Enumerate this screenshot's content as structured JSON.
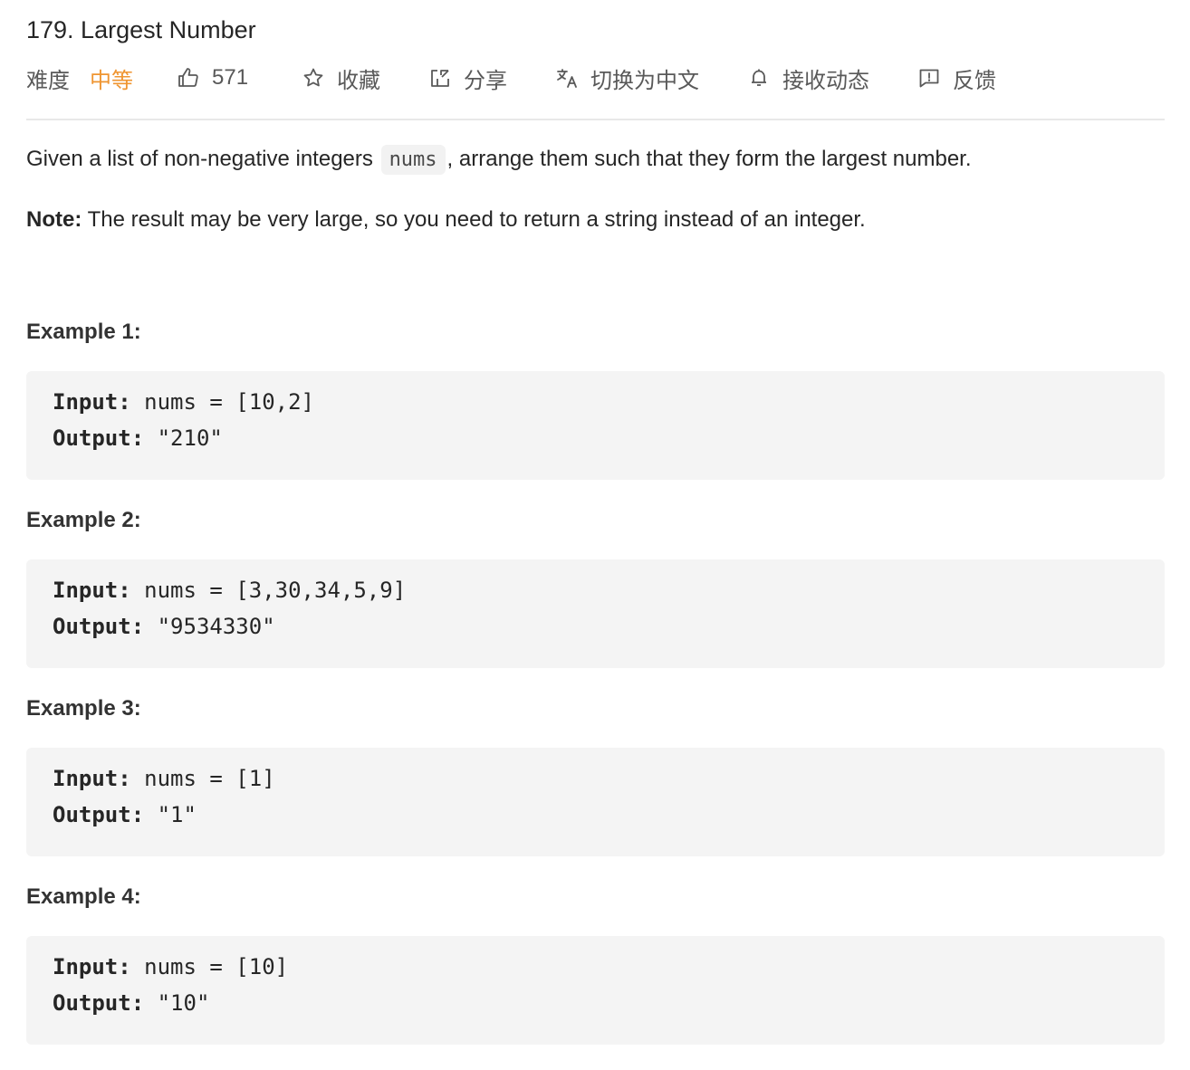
{
  "problem": {
    "title": "179. Largest Number"
  },
  "toolbar": {
    "difficulty_label": "难度",
    "difficulty_value": "中等",
    "likes": "571",
    "favorite": "收藏",
    "share": "分享",
    "translate": "切换为中文",
    "subscribe": "接收动态",
    "feedback": "反馈",
    "icons": {
      "likes": "thumbs-up-icon",
      "favorite": "star-icon",
      "share": "share-icon",
      "translate": "translate-icon",
      "subscribe": "bell-icon",
      "feedback": "feedback-icon"
    },
    "difficulty_color": "#ef9531"
  },
  "description": {
    "p1_before": "Given a list of non-negative integers",
    "p1_code": "nums",
    "p1_after": ", arrange them such that they form the largest number.",
    "note_label": "Note:",
    "note_text": " The result may be very large, so you need to return a string instead of an integer."
  },
  "examples": [
    {
      "title": "Example 1:",
      "input_label": "Input:",
      "input": " nums = [10,2]",
      "output_label": "Output:",
      "output": " \"210\""
    },
    {
      "title": "Example 2:",
      "input_label": "Input:",
      "input": " nums = [3,30,34,5,9]",
      "output_label": "Output:",
      "output": " \"9534330\""
    },
    {
      "title": "Example 3:",
      "input_label": "Input:",
      "input": " nums = [1]",
      "output_label": "Output:",
      "output": " \"1\""
    },
    {
      "title": "Example 4:",
      "input_label": "Input:",
      "input": " nums = [10]",
      "output_label": "Output:",
      "output": " \"10\""
    }
  ]
}
